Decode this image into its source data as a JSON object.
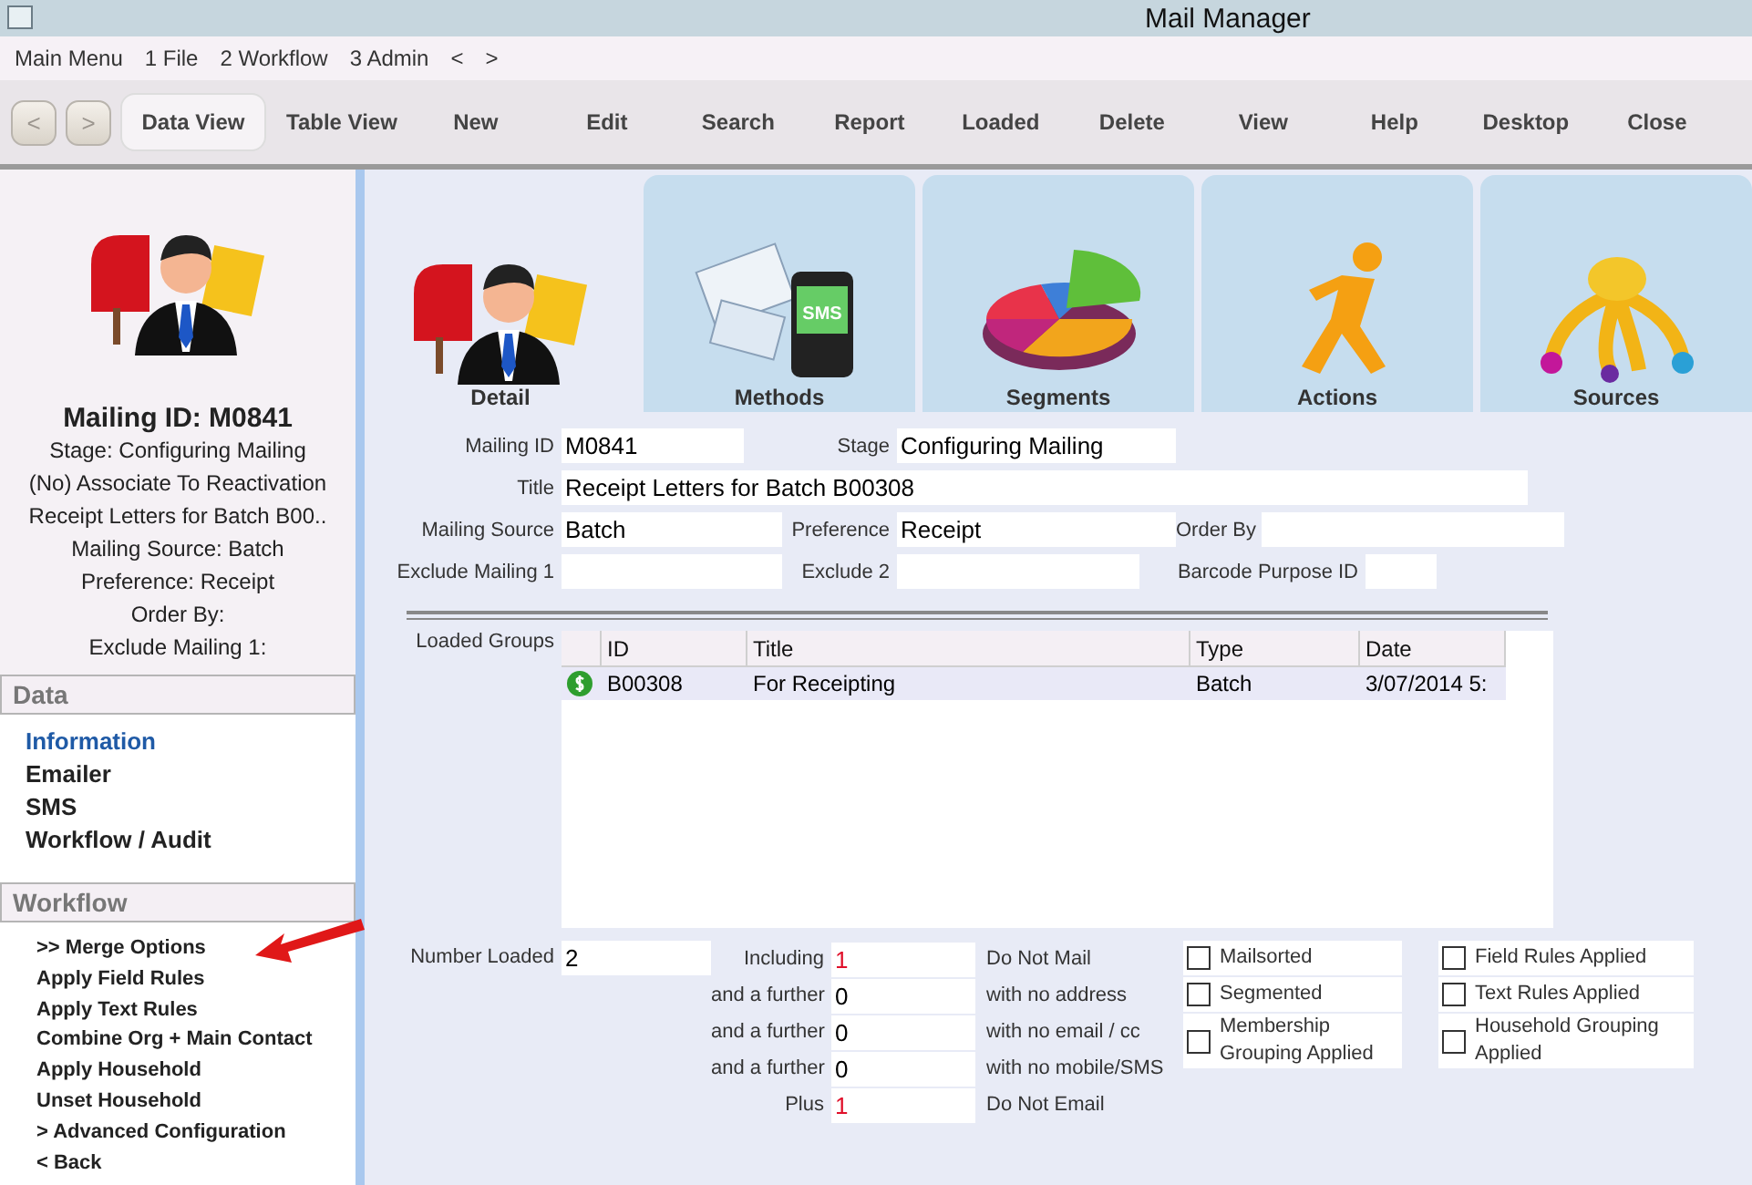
{
  "window": {
    "title": "Mail Manager"
  },
  "menu": [
    "Main Menu",
    "1 File",
    "2 Workflow",
    "3 Admin",
    "<",
    ">"
  ],
  "nav_buttons": [
    "<",
    ">"
  ],
  "toolbar": [
    {
      "label": "Data View",
      "selected": true
    },
    {
      "label": "Table View",
      "selected": false
    },
    {
      "label": "New",
      "selected": false
    },
    {
      "label": "Edit",
      "selected": false
    },
    {
      "label": "Search",
      "selected": false
    },
    {
      "label": "Report",
      "selected": false
    },
    {
      "label": "Loaded",
      "selected": false
    },
    {
      "label": "Delete",
      "selected": false
    },
    {
      "label": "View",
      "selected": false
    },
    {
      "label": "Help",
      "selected": false
    },
    {
      "label": "Desktop",
      "selected": false
    },
    {
      "label": "Close",
      "selected": false
    }
  ],
  "sidebar": {
    "heading": "Mailing ID: M0841",
    "summary": [
      "Stage: Configuring Mailing",
      "(No) Associate To Reactivation",
      "Receipt Letters for Batch B00..",
      "Mailing Source: Batch",
      "Preference: Receipt",
      "Order By:",
      "Exclude Mailing 1:"
    ],
    "data_title": "Data",
    "data_items": [
      {
        "label": "Information",
        "selected": true
      },
      {
        "label": "Emailer",
        "selected": false
      },
      {
        "label": "SMS",
        "selected": false
      },
      {
        "label": "Workflow / Audit",
        "selected": false
      }
    ],
    "workflow_title": "Workflow",
    "workflow_items": [
      ">> Merge Options",
      "Apply Field Rules",
      "Apply Text Rules",
      "Combine Org + Main Contact",
      "Apply Household",
      "Unset Household",
      "> Advanced Configuration",
      "< Back"
    ]
  },
  "tabs": [
    {
      "label": "Detail",
      "kind": "person",
      "selected": true
    },
    {
      "label": "Methods",
      "kind": "phone",
      "badge": "SMS",
      "selected": false
    },
    {
      "label": "Segments",
      "kind": "pie",
      "selected": false
    },
    {
      "label": "Actions",
      "kind": "runner",
      "selected": false
    },
    {
      "label": "Sources",
      "kind": "coin",
      "selected": false
    }
  ],
  "form": {
    "mailing_id": {
      "label": "Mailing ID",
      "value": "M0841"
    },
    "stage": {
      "label": "Stage",
      "value": "Configuring Mailing"
    },
    "title": {
      "label": "Title",
      "value": "Receipt Letters for Batch B00308"
    },
    "mailing_source": {
      "label": "Mailing Source",
      "value": "Batch"
    },
    "preference": {
      "label": "Preference",
      "value": "Receipt"
    },
    "order_by": {
      "label": "Order By"
    },
    "exclude_mailing_1": {
      "label": "Exclude Mailing 1"
    },
    "exclude_2": {
      "label": "Exclude 2"
    },
    "barcode_purpose_id": {
      "label": "Barcode Purpose ID"
    }
  },
  "loaded_groups": {
    "label": "Loaded Groups",
    "columns": [
      "ID",
      "Title",
      "Type",
      "Date"
    ],
    "rows": [
      {
        "cells": [
          "B00308",
          "For Receipting",
          "Batch",
          "3/07/2014 5:"
        ],
        "selected": true
      }
    ]
  },
  "number_loaded": {
    "label": "Number Loaded",
    "value": "2"
  },
  "counts": [
    {
      "label": "Including",
      "value": "1",
      "color": "#e0102a",
      "note": "Do Not Mail"
    },
    {
      "label": "and a further",
      "value": "0",
      "color": "#000000",
      "note": "with no address"
    },
    {
      "label": "and a further",
      "value": "0",
      "color": "#000000",
      "note": "with no email / cc"
    },
    {
      "label": "and a further",
      "value": "0",
      "color": "#000000",
      "note": "with no mobile/SMS"
    },
    {
      "label": "Plus",
      "value": "1",
      "color": "#e0102a",
      "note": "Do Not Email"
    }
  ],
  "checks": [
    {
      "label": "Mailsorted",
      "checked": false
    },
    {
      "label": "Field Rules Applied",
      "checked": false
    },
    {
      "label": "Segmented",
      "checked": false
    },
    {
      "label": "Text Rules Applied",
      "checked": false
    },
    {
      "label": "Membership Grouping Applied",
      "checked": false
    },
    {
      "label": "Household Grouping Applied",
      "checked": false
    }
  ]
}
